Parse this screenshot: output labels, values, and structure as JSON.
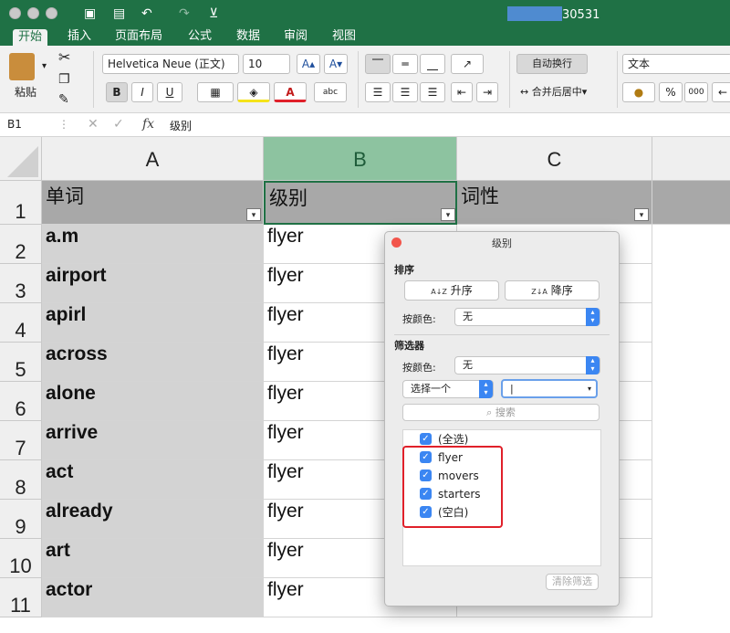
{
  "titlebar": {
    "filename_suffix": "30531",
    "undo_glyph": "↶",
    "redo_glyph": "↷",
    "customize_glyph": "⊻",
    "book_glyph": "▣",
    "save_glyph": "▤"
  },
  "tabs": [
    "开始",
    "插入",
    "页面布局",
    "公式",
    "数据",
    "审阅",
    "视图"
  ],
  "ribbon": {
    "paste_label": "粘贴",
    "font_name": "Helvetica Neue (正文)",
    "font_size": "10",
    "bold": "B",
    "italic": "I",
    "underline": "U",
    "font_grow": "A▴",
    "font_shrink": "A▾",
    "abc": "abc",
    "wrap_text": "自动换行",
    "merge_center": "合并后居中",
    "number_format": "文本",
    "percent": "%",
    "thousands": "000",
    "dropdown": "▾"
  },
  "formula_bar": {
    "cell_ref": "B1",
    "cancel": "✕",
    "enter": "✓",
    "fx": "fx",
    "content": "级别"
  },
  "grid": {
    "columns": [
      "A",
      "B",
      "C"
    ],
    "row_numbers": [
      "1",
      "2",
      "3",
      "4",
      "5",
      "6",
      "7",
      "8",
      "9",
      "10",
      "11"
    ],
    "headers": [
      "单词",
      "级别",
      "词性"
    ],
    "words": [
      "a.m",
      "airport",
      "apirl",
      "across",
      "alone",
      "arrive",
      "act",
      "already",
      "art",
      "actor"
    ],
    "levels": [
      "flyer",
      "flyer",
      "flyer",
      "flyer",
      "flyer",
      "flyer",
      "flyer",
      "flyer",
      "flyer",
      "flyer"
    ],
    "filter_glyph": "▾"
  },
  "dialog": {
    "title": "级别",
    "sort_section": "排序",
    "ascending": "升序",
    "descending": "降序",
    "sort_icon_asc": "A↓Z",
    "sort_icon_desc": "Z↓A",
    "by_color": "按颜色:",
    "sort_color_value": "无",
    "filter_section": "筛选器",
    "filter_color_value": "无",
    "choose_one": "选择一个",
    "criteria_value": "",
    "search_placeholder": "搜索",
    "list": [
      "(全选)",
      "flyer",
      "movers",
      "starters",
      "(空白)"
    ],
    "check_glyph": "✓",
    "clear_filter": "清除筛选"
  },
  "colors": {
    "accent": "#1f7145",
    "selected_header": "#8dc3a0",
    "header_band": "#a8a8a8",
    "col_a_fill": "#d3d3d3",
    "highlight": "#e0202a",
    "checkbox": "#3b86f2"
  }
}
